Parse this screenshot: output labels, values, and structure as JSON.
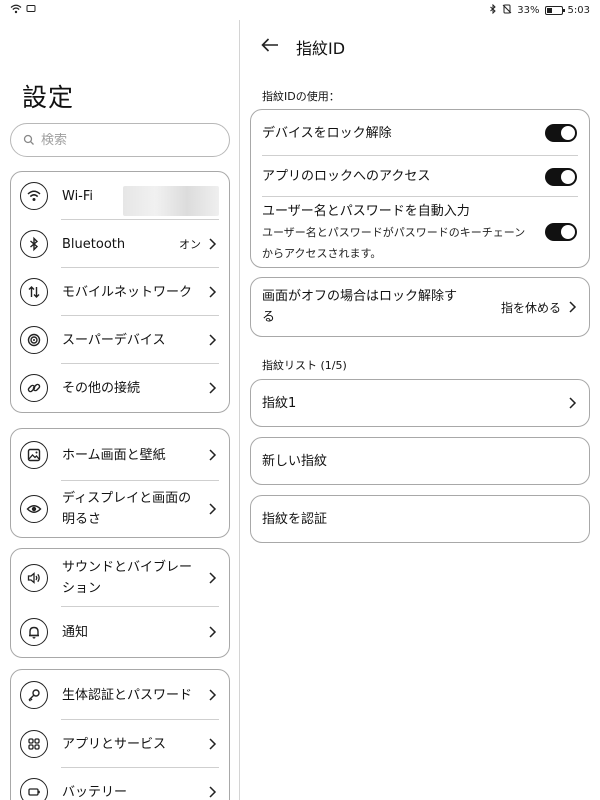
{
  "status_bar": {
    "battery_percent": "33%",
    "time": "5:03",
    "battery_level": 0.33
  },
  "left": {
    "title": "設定",
    "search_placeholder": "検索",
    "groups": [
      {
        "items": [
          {
            "label": "Wi-Fi",
            "value": "",
            "icon": "wifi-icon"
          },
          {
            "label": "Bluetooth",
            "value": "オン",
            "icon": "bluetooth-icon"
          },
          {
            "label": "モバイルネットワーク",
            "value": "",
            "icon": "mobile-network-icon"
          },
          {
            "label": "スーパーデバイス",
            "value": "",
            "icon": "super-device-icon"
          },
          {
            "label": "その他の接続",
            "value": "",
            "icon": "link-icon"
          }
        ]
      },
      {
        "items": [
          {
            "label": "ホーム画面と壁紙",
            "value": "",
            "icon": "wallpaper-icon"
          },
          {
            "label_line1": "ディスプレイと画面の",
            "label_line2": "明るさ",
            "value": "",
            "icon": "eye-icon"
          }
        ]
      },
      {
        "items": [
          {
            "label_line1": "サウンドとバイブレー",
            "label_line2": "ション",
            "value": "",
            "icon": "speaker-icon"
          },
          {
            "label": "通知",
            "value": "",
            "icon": "bell-icon"
          }
        ]
      },
      {
        "items": [
          {
            "label": "生体認証とパスワード",
            "value": "",
            "icon": "key-icon"
          },
          {
            "label": "アプリとサービス",
            "value": "",
            "icon": "apps-grid-icon"
          },
          {
            "label": "バッテリー",
            "value": "",
            "icon": "battery-icon"
          }
        ]
      }
    ]
  },
  "right": {
    "title": "指紋ID",
    "usage_section_label": "指紋IDの使用：",
    "usage_items": [
      {
        "label": "デバイスをロック解除",
        "enabled": true
      },
      {
        "label": "アプリのロックへのアクセス",
        "enabled": true
      },
      {
        "label": "ユーザー名とパスワードを自動入力",
        "sublabel_line1": "ユーザー名とパスワードがパスワードのキーチェーン",
        "sublabel_line2": "からアクセスされます。",
        "enabled": true
      }
    ],
    "screen_off": {
      "label_line1": "画面がオフの場合はロック解除す",
      "label_line2": "る",
      "value": "指を休める"
    },
    "list_section_label": "指紋リスト (1/5)",
    "fingerprint_items": [
      {
        "label": "指紋1"
      }
    ],
    "new_fingerprint_label": "新しい指紋",
    "verify_fingerprint_label": "指紋を認証"
  }
}
